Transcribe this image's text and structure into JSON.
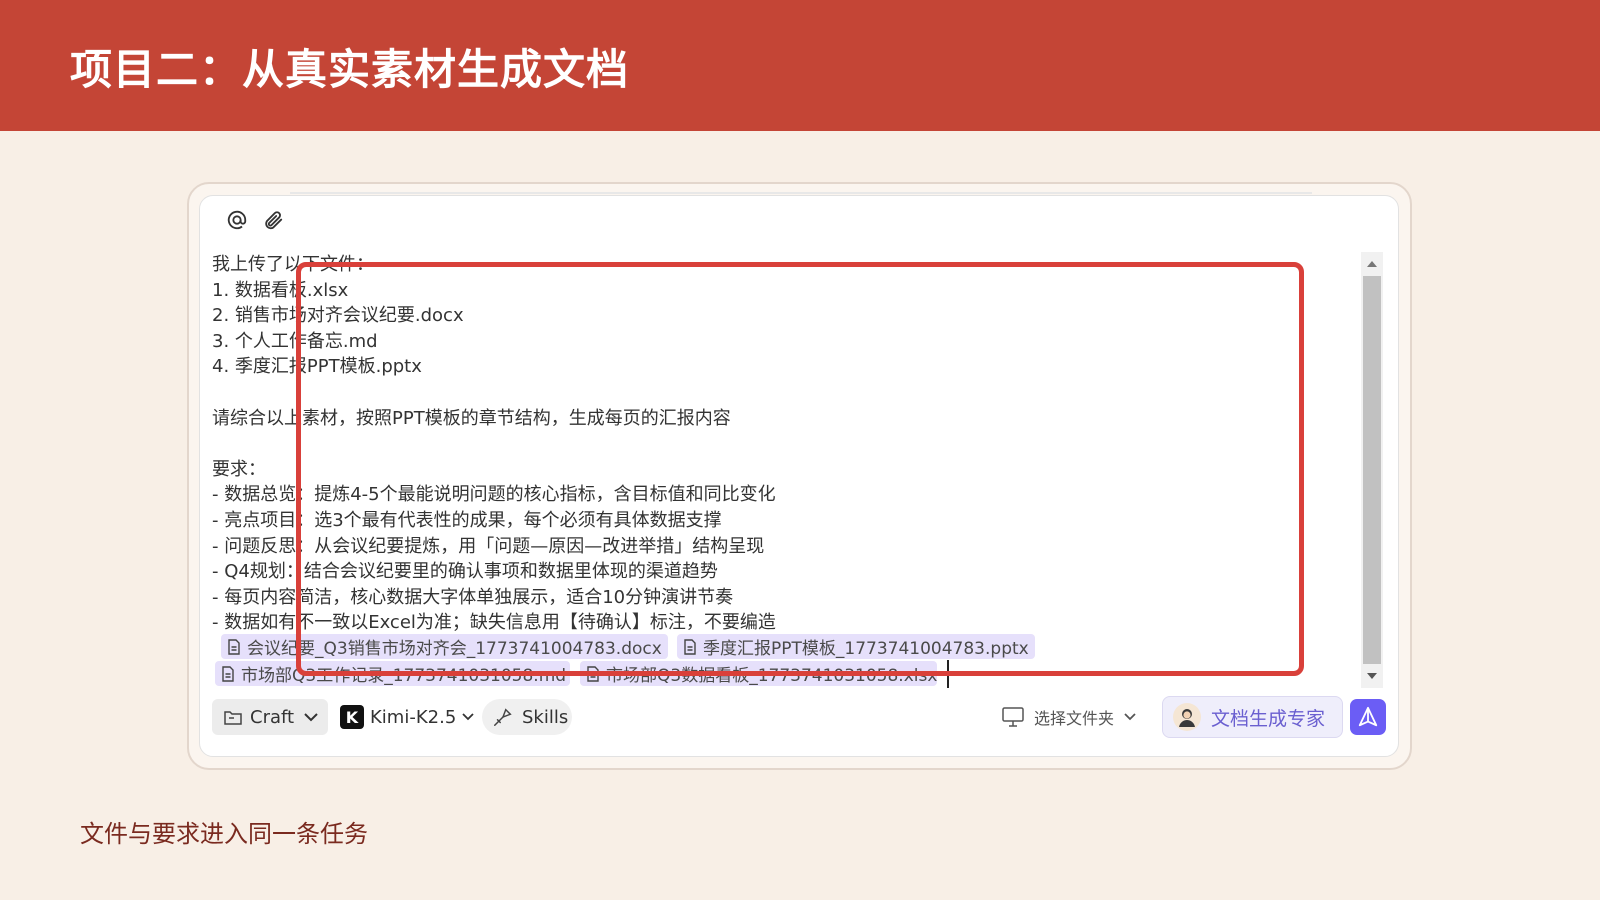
{
  "header": {
    "title": "项目二：从真实素材生成文档"
  },
  "composer": {
    "message_lines": [
      "我上传了以下文件：",
      "1. 数据看板.xlsx",
      "2. 销售市场对齐会议纪要.docx",
      "3. 个人工作备忘.md",
      "4. 季度汇报PPT模板.pptx",
      "",
      "请综合以上素材，按照PPT模板的章节结构，生成每页的汇报内容",
      "",
      "要求：",
      "- 数据总览：提炼4-5个最能说明问题的核心指标，含目标值和同比变化",
      "- 亮点项目：选3个最有代表性的成果，每个必须有具体数据支撑",
      "- 问题反思：从会议纪要提炼，用「问题—原因—改进举措」结构呈现",
      "- Q4规划：结合会议纪要里的确认事项和数据里体现的渠道趋势",
      "- 每页内容简洁，核心数据大字体单独展示，适合10分钟演讲节奏",
      "- 数据如有不一致以Excel为准；缺失信息用【待确认】标注，不要编造"
    ],
    "attachments": [
      "会议纪要_Q3销售市场对齐会_1773741004783.docx",
      "季度汇报PPT模板_1773741004783.pptx",
      "市场部Q3工作记录_1773741031058.md",
      "市场部Q3数据看板_1773741031058.xlsx"
    ]
  },
  "toolbar": {
    "craft_label": "Craft",
    "model_label": "Kimi-K2.5",
    "model_logo": "K",
    "skills_label": "Skills",
    "folder_label": "选择文件夹",
    "expert_label": "文档生成专家"
  },
  "caption": "文件与要求进入同一条任务",
  "colors": {
    "header_bg": "#c44536",
    "page_bg": "#f8efe6",
    "highlight_border": "#d9403a",
    "chip_bg": "#e6e0fb",
    "send_button": "#6b5df5",
    "expert_text": "#6a5fd0"
  }
}
